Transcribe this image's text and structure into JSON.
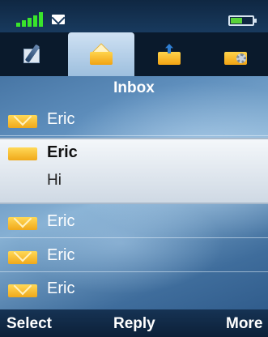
{
  "status": {
    "signal_icon": "signal-bars-icon",
    "message_icon": "envelope-icon",
    "battery_icon": "battery-icon",
    "battery_level": 0.55
  },
  "tabs": [
    {
      "icon": "compose-icon",
      "active": false
    },
    {
      "icon": "inbox-icon",
      "active": true
    },
    {
      "icon": "outbox-icon",
      "active": false
    },
    {
      "icon": "mail-settings-icon",
      "active": false
    }
  ],
  "title": "Inbox",
  "messages": [
    {
      "sender": "Eric",
      "preview": ""
    },
    {
      "sender": "Eric",
      "preview": "Hi"
    },
    {
      "sender": "Eric",
      "preview": ""
    },
    {
      "sender": "Eric",
      "preview": ""
    },
    {
      "sender": "Eric",
      "preview": ""
    }
  ],
  "softkeys": {
    "left": "Select",
    "center": "Reply",
    "right": "More"
  }
}
